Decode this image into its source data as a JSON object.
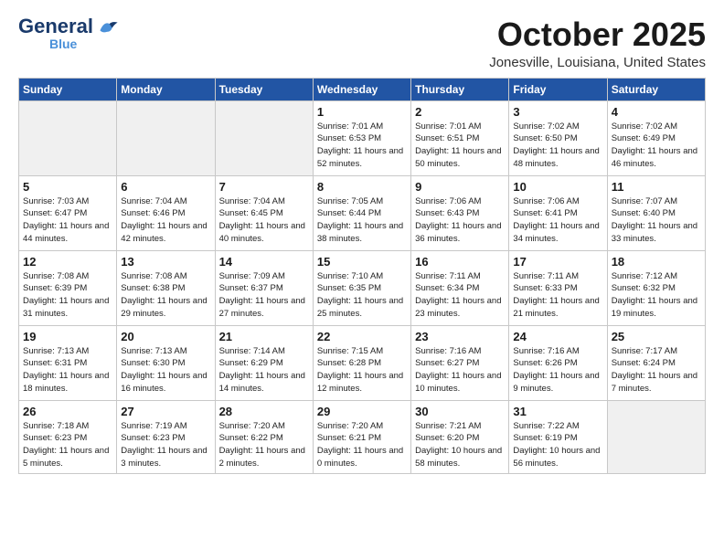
{
  "header": {
    "logo_general": "General",
    "logo_blue": "Blue",
    "month_title": "October 2025",
    "location": "Jonesville, Louisiana, United States"
  },
  "days_of_week": [
    "Sunday",
    "Monday",
    "Tuesday",
    "Wednesday",
    "Thursday",
    "Friday",
    "Saturday"
  ],
  "weeks": [
    [
      {
        "day": "",
        "empty": true
      },
      {
        "day": "",
        "empty": true
      },
      {
        "day": "",
        "empty": true
      },
      {
        "day": "1",
        "sunrise": "7:01 AM",
        "sunset": "6:53 PM",
        "daylight": "11 hours and 52 minutes."
      },
      {
        "day": "2",
        "sunrise": "7:01 AM",
        "sunset": "6:51 PM",
        "daylight": "11 hours and 50 minutes."
      },
      {
        "day": "3",
        "sunrise": "7:02 AM",
        "sunset": "6:50 PM",
        "daylight": "11 hours and 48 minutes."
      },
      {
        "day": "4",
        "sunrise": "7:02 AM",
        "sunset": "6:49 PM",
        "daylight": "11 hours and 46 minutes."
      }
    ],
    [
      {
        "day": "5",
        "sunrise": "7:03 AM",
        "sunset": "6:47 PM",
        "daylight": "11 hours and 44 minutes."
      },
      {
        "day": "6",
        "sunrise": "7:04 AM",
        "sunset": "6:46 PM",
        "daylight": "11 hours and 42 minutes."
      },
      {
        "day": "7",
        "sunrise": "7:04 AM",
        "sunset": "6:45 PM",
        "daylight": "11 hours and 40 minutes."
      },
      {
        "day": "8",
        "sunrise": "7:05 AM",
        "sunset": "6:44 PM",
        "daylight": "11 hours and 38 minutes."
      },
      {
        "day": "9",
        "sunrise": "7:06 AM",
        "sunset": "6:43 PM",
        "daylight": "11 hours and 36 minutes."
      },
      {
        "day": "10",
        "sunrise": "7:06 AM",
        "sunset": "6:41 PM",
        "daylight": "11 hours and 34 minutes."
      },
      {
        "day": "11",
        "sunrise": "7:07 AM",
        "sunset": "6:40 PM",
        "daylight": "11 hours and 33 minutes."
      }
    ],
    [
      {
        "day": "12",
        "sunrise": "7:08 AM",
        "sunset": "6:39 PM",
        "daylight": "11 hours and 31 minutes."
      },
      {
        "day": "13",
        "sunrise": "7:08 AM",
        "sunset": "6:38 PM",
        "daylight": "11 hours and 29 minutes."
      },
      {
        "day": "14",
        "sunrise": "7:09 AM",
        "sunset": "6:37 PM",
        "daylight": "11 hours and 27 minutes."
      },
      {
        "day": "15",
        "sunrise": "7:10 AM",
        "sunset": "6:35 PM",
        "daylight": "11 hours and 25 minutes."
      },
      {
        "day": "16",
        "sunrise": "7:11 AM",
        "sunset": "6:34 PM",
        "daylight": "11 hours and 23 minutes."
      },
      {
        "day": "17",
        "sunrise": "7:11 AM",
        "sunset": "6:33 PM",
        "daylight": "11 hours and 21 minutes."
      },
      {
        "day": "18",
        "sunrise": "7:12 AM",
        "sunset": "6:32 PM",
        "daylight": "11 hours and 19 minutes."
      }
    ],
    [
      {
        "day": "19",
        "sunrise": "7:13 AM",
        "sunset": "6:31 PM",
        "daylight": "11 hours and 18 minutes."
      },
      {
        "day": "20",
        "sunrise": "7:13 AM",
        "sunset": "6:30 PM",
        "daylight": "11 hours and 16 minutes."
      },
      {
        "day": "21",
        "sunrise": "7:14 AM",
        "sunset": "6:29 PM",
        "daylight": "11 hours and 14 minutes."
      },
      {
        "day": "22",
        "sunrise": "7:15 AM",
        "sunset": "6:28 PM",
        "daylight": "11 hours and 12 minutes."
      },
      {
        "day": "23",
        "sunrise": "7:16 AM",
        "sunset": "6:27 PM",
        "daylight": "11 hours and 10 minutes."
      },
      {
        "day": "24",
        "sunrise": "7:16 AM",
        "sunset": "6:26 PM",
        "daylight": "11 hours and 9 minutes."
      },
      {
        "day": "25",
        "sunrise": "7:17 AM",
        "sunset": "6:24 PM",
        "daylight": "11 hours and 7 minutes."
      }
    ],
    [
      {
        "day": "26",
        "sunrise": "7:18 AM",
        "sunset": "6:23 PM",
        "daylight": "11 hours and 5 minutes."
      },
      {
        "day": "27",
        "sunrise": "7:19 AM",
        "sunset": "6:23 PM",
        "daylight": "11 hours and 3 minutes."
      },
      {
        "day": "28",
        "sunrise": "7:20 AM",
        "sunset": "6:22 PM",
        "daylight": "11 hours and 2 minutes."
      },
      {
        "day": "29",
        "sunrise": "7:20 AM",
        "sunset": "6:21 PM",
        "daylight": "11 hours and 0 minutes."
      },
      {
        "day": "30",
        "sunrise": "7:21 AM",
        "sunset": "6:20 PM",
        "daylight": "10 hours and 58 minutes."
      },
      {
        "day": "31",
        "sunrise": "7:22 AM",
        "sunset": "6:19 PM",
        "daylight": "10 hours and 56 minutes."
      },
      {
        "day": "",
        "empty": true
      }
    ]
  ]
}
